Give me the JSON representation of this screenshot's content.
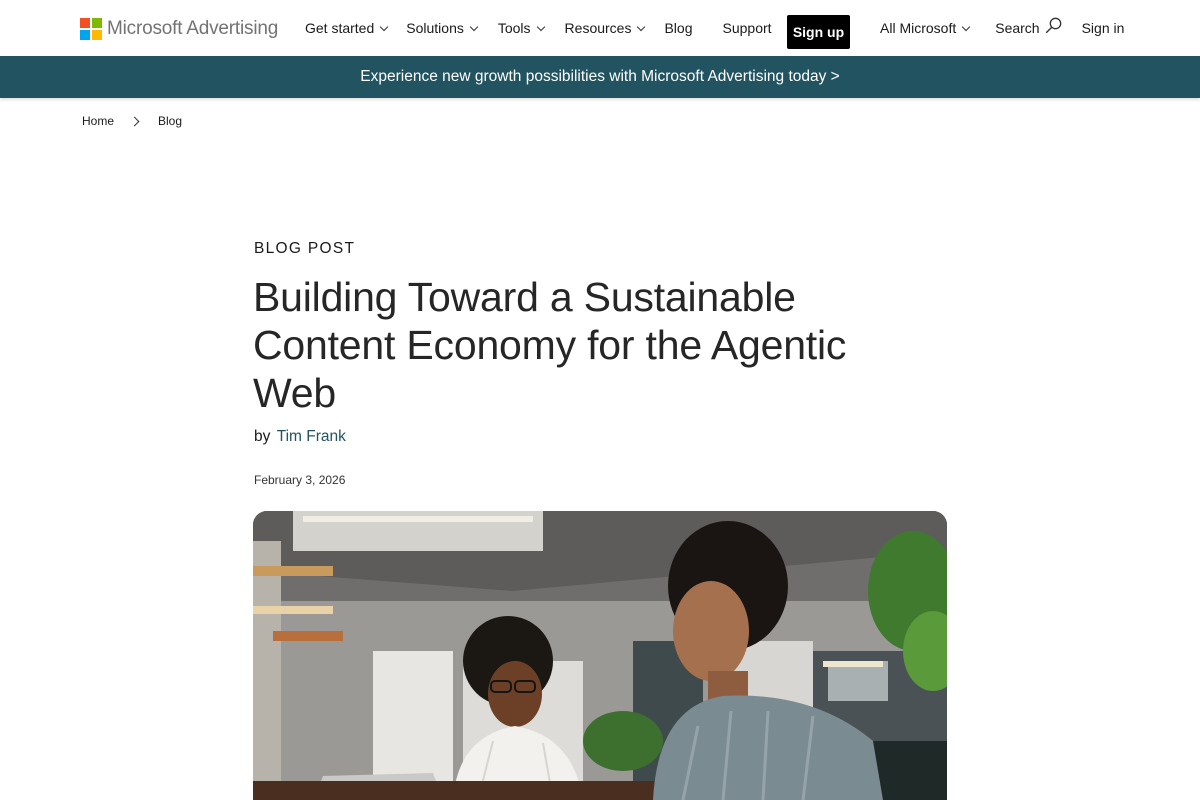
{
  "header": {
    "logo": {
      "text": "Microsoft Advertising",
      "colors": [
        "#f25022",
        "#7fba00",
        "#00a4ef",
        "#ffb900"
      ]
    },
    "nav": [
      {
        "label": "Get started",
        "has_dropdown": true
      },
      {
        "label": "Solutions",
        "has_dropdown": true
      },
      {
        "label": "Tools",
        "has_dropdown": true
      },
      {
        "label": "Resources",
        "has_dropdown": true
      },
      {
        "label": "Blog",
        "has_dropdown": false
      },
      {
        "label": "Support",
        "has_dropdown": false
      }
    ],
    "signup_label": "Sign up",
    "all_microsoft_label": "All Microsoft",
    "search_label": "Search",
    "search_icon": "search-icon",
    "signin_label": "Sign in"
  },
  "banner": {
    "text": "Experience new growth possibilities with Microsoft Advertising today >",
    "background": "#225360"
  },
  "breadcrumb": {
    "items": [
      "Home",
      "Blog"
    ],
    "separator_icon": "chevron-right-icon"
  },
  "article": {
    "kicker": "BLOG POST",
    "title": "Building Toward a Sustainable Content Economy for the Agentic Web",
    "by_label": "by",
    "author": "Tim Frank",
    "date": "February 3, 2026",
    "accent_color": "#225360"
  }
}
